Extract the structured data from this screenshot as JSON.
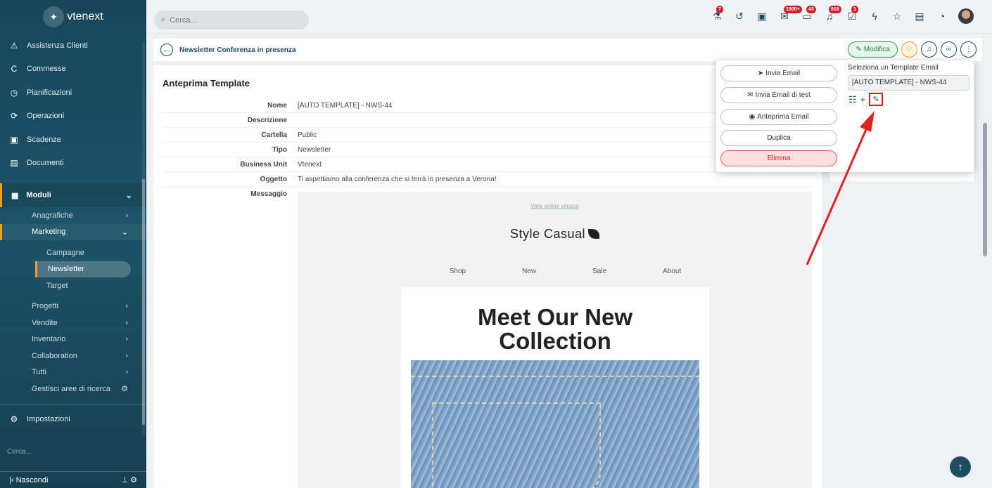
{
  "app": {
    "name": "vtenext"
  },
  "sidebar": {
    "top_items": [
      {
        "label": "Assistenza Clienti",
        "icon": "warning-icon"
      },
      {
        "label": "Commesse",
        "icon": "c-icon"
      },
      {
        "label": "Pianificazioni",
        "icon": "clock-icon"
      },
      {
        "label": "Operazioni",
        "icon": "gear-c-icon"
      },
      {
        "label": "Scadenze",
        "icon": "calendar-icon"
      },
      {
        "label": "Documenti",
        "icon": "doc-icon"
      }
    ],
    "moduli_label": "Moduli",
    "modules": {
      "anagrafiche": "Anagrafiche",
      "marketing": "Marketing",
      "campagne": "Campagne",
      "newsletter": "Newsletter",
      "target": "Target",
      "progetti": "Progetti",
      "vendite": "Vendite",
      "inventario": "Inventario",
      "collaboration": "Collaboration",
      "tutti": "Tutti",
      "gestisci": "Gestisci aree di ricerca"
    },
    "impostazioni": "Impostazioni",
    "search_placeholder": "Cerca...",
    "nascondi": "Nascondi"
  },
  "topbar": {
    "search_placeholder": "Cerca...",
    "badges": {
      "b1": "7",
      "mail": "1000+",
      "chat": "43",
      "notif": "616",
      "tasks": "1"
    }
  },
  "header": {
    "title": "Newsletter Conferenza in presenza",
    "modifica": "Modifica"
  },
  "details": {
    "section_title": "Anteprima Template",
    "fields": [
      {
        "label": "Nome",
        "value": "[AUTO TEMPLATE] - NWS-44"
      },
      {
        "label": "Descrizione",
        "value": ""
      },
      {
        "label": "Cartella",
        "value": "Public"
      },
      {
        "label": "Tipo",
        "value": "Newsletter"
      },
      {
        "label": "Business Unit",
        "value": "Vtenext"
      },
      {
        "label": "Oggetto",
        "value": "Ti aspettiamo alla conferenza che si terrà in presenza a Verona!"
      },
      {
        "label": "Messaggio",
        "value": ""
      }
    ]
  },
  "preview": {
    "view_online": "View online version",
    "brand": "Style Casual",
    "nav": [
      "Shop",
      "New",
      "Sale",
      "About"
    ],
    "headline_1": "Meet Our New",
    "headline_2": "Collection"
  },
  "popup": {
    "invia_email": "Invia Email",
    "invia_test": "Invia Email di test",
    "anteprima": "Anteprima Email",
    "duplica": "Duplica",
    "elimina": "Elimina",
    "tpl_label": "Seleziona un Template Email",
    "tpl_value": "[AUTO TEMPLATE] - NWS-44"
  },
  "colors": {
    "sidebar": "#1d5367",
    "accent": "#f0a020",
    "annotation": "#e02020"
  }
}
